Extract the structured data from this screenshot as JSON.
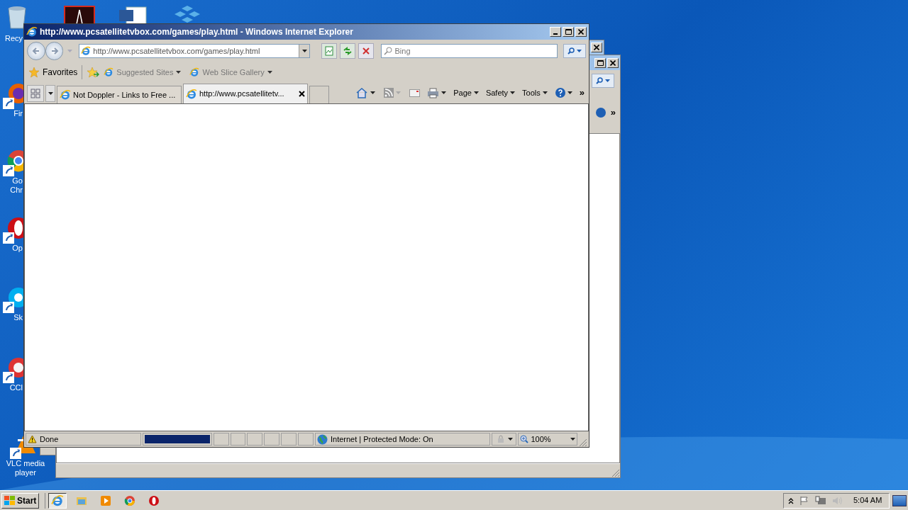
{
  "desktop_icons": [
    {
      "kind": "recycle",
      "lines": [
        "Recy"
      ]
    },
    {
      "kind": "firefox",
      "lines": [
        "Fir"
      ]
    },
    {
      "kind": "chrome",
      "lines": [
        "Go",
        "Chr"
      ]
    },
    {
      "kind": "opera",
      "lines": [
        "Op"
      ]
    },
    {
      "kind": "skype",
      "lines": [
        "Sk"
      ]
    },
    {
      "kind": "ccleaner",
      "lines": [
        "CCl"
      ]
    },
    {
      "kind": "vlc",
      "lines": [
        "VLC media",
        "player"
      ]
    }
  ],
  "back_window": {
    "chevron": "»"
  },
  "window": {
    "title": "http://www.pcsatellitetvbox.com/games/play.html - Windows Internet Explorer",
    "address": "http://www.pcsatellitetvbox.com/games/play.html",
    "search_placeholder": "Bing",
    "favorites": "Favorites",
    "favorite_links": [
      "Suggested Sites",
      "Web Slice Gallery"
    ],
    "tabs": [
      {
        "label": "Not Doppler - Links to Free ...",
        "selected": false
      },
      {
        "label": "http://www.pcsatellitetv...",
        "selected": true
      }
    ],
    "commands": [
      "Page",
      "Safety",
      "Tools"
    ],
    "chevron": "»",
    "status": {
      "text": "Done",
      "level": 1,
      "zone": "Internet | Protected Mode: On",
      "zoom": "100%"
    }
  },
  "taskbar": {
    "start": "Start",
    "apps": [
      {
        "kind": "ie",
        "selected": true
      },
      {
        "kind": "explorer",
        "selected": false
      },
      {
        "kind": "media",
        "selected": false
      },
      {
        "kind": "chrome",
        "selected": false
      },
      {
        "kind": "opera",
        "selected": false
      }
    ],
    "clock": "5:04 AM"
  }
}
